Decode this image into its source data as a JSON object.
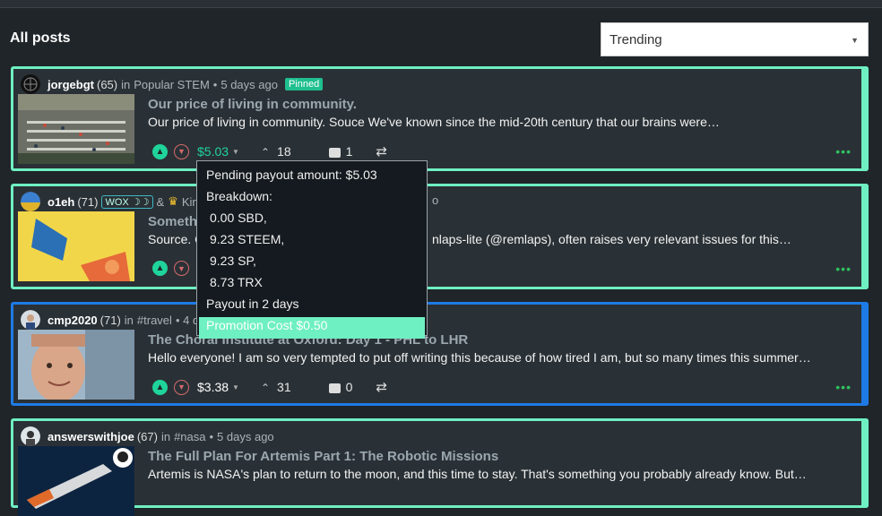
{
  "header": {
    "title": "All posts"
  },
  "sort": {
    "selected": "Trending"
  },
  "posts": [
    {
      "author": "jorgebgt",
      "rep": "(65)",
      "in": "in",
      "community": "Popular STEM",
      "age": "5 days ago",
      "pinned": "Pinned",
      "title": "Our price of living in community.",
      "excerpt": "Our price of living in community. Souce We've known since the mid-20th century that our brains were…",
      "payout": "$5.03",
      "votes": "18",
      "comments": "1"
    },
    {
      "author": "o1eh",
      "rep": "(71)",
      "badge": "WOX",
      "amp": "&",
      "badge2": "Kin",
      "title_partial": "Somethi",
      "excerpt_left": "Source. C",
      "excerpt_right": "nlaps-lite (@remlaps), often raises very relevant issues for this…",
      "age_partial": "o"
    },
    {
      "author": "cmp2020",
      "rep": "(71)",
      "in": "in",
      "community": "#travel",
      "age_partial": "• 4 d",
      "title_partial": "The Choral Institute at Oxford: Day 1 - PHL to LHR",
      "excerpt": "Hello everyone! I am so very tempted to put off writing this because of how tired I am, but so many times this summer…",
      "payout": "$3.38",
      "votes": "31",
      "comments": "0"
    },
    {
      "author": "answerswithjoe",
      "rep": "(67)",
      "in": "in",
      "community": "#nasa",
      "age": "5 days ago",
      "title": "The Full Plan For Artemis Part 1: The Robotic Missions",
      "excerpt": "Artemis is NASA's plan to return to the moon, and this time to stay. That's something you probably already know. But…"
    }
  ],
  "tooltip": {
    "pending": "Pending payout amount: $5.03",
    "breakdown": "Breakdown:",
    "sbd": "0.00 SBD,",
    "steem": "9.23 STEEM,",
    "sp": "9.23 SP,",
    "trx": "8.73 TRX",
    "payout_in": "Payout in 2 days",
    "promotion": "Promotion Cost $0.50"
  },
  "colors": {
    "accent": "#6ff0c2",
    "blue": "#1e7be6",
    "upvote": "#1fd49b",
    "background": "#1f2529"
  }
}
